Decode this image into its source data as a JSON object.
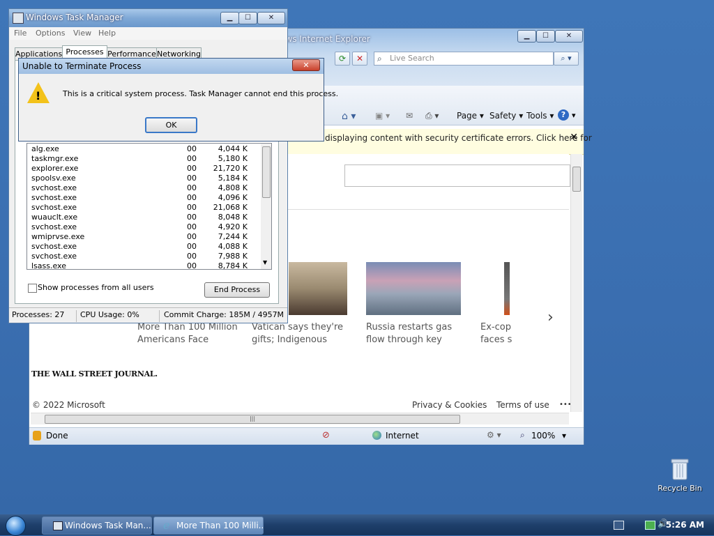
{
  "desktop": {
    "recycle_bin_label": "Recycle Bin"
  },
  "ie": {
    "title": "Windows Internet Explorer",
    "search_placeholder": "Live Search",
    "commands": [
      "Page",
      "Safety",
      "Tools"
    ],
    "infobar_message": "displaying content with security certificate errors. Click here for",
    "news": [
      {
        "line1": "More Than 100 Million",
        "line2": "Americans Face"
      },
      {
        "line1": "Vatican says they're",
        "line2": "gifts; Indigenous"
      },
      {
        "line1": "Russia restarts gas",
        "line2": "flow through key"
      },
      {
        "line1": "Ex-cop",
        "line2": "faces s"
      }
    ],
    "wsj_logo": "THE WALL STREET JOURNAL.",
    "footer_copyright": "© 2022 Microsoft",
    "footer_privacy": "Privacy & Cookies",
    "footer_terms": "Terms of use",
    "footer_more": "•••",
    "status_done": "Done",
    "status_zone": "Internet",
    "status_zoom": "100%"
  },
  "taskmgr": {
    "title": "Windows Task Manager",
    "menu": [
      "File",
      "Options",
      "View",
      "Help"
    ],
    "tabs": [
      "Applications",
      "Processes",
      "Performance",
      "Networking"
    ],
    "processes": [
      {
        "name": "alg.exe",
        "cpu": "00",
        "mem": "4,044 K"
      },
      {
        "name": "taskmgr.exe",
        "cpu": "00",
        "mem": "5,180 K"
      },
      {
        "name": "explorer.exe",
        "cpu": "00",
        "mem": "21,720 K"
      },
      {
        "name": "spoolsv.exe",
        "cpu": "00",
        "mem": "5,184 K"
      },
      {
        "name": "svchost.exe",
        "cpu": "00",
        "mem": "4,808 K"
      },
      {
        "name": "svchost.exe",
        "cpu": "00",
        "mem": "4,096 K"
      },
      {
        "name": "svchost.exe",
        "cpu": "00",
        "mem": "21,068 K"
      },
      {
        "name": "wuauclt.exe",
        "cpu": "00",
        "mem": "8,048 K"
      },
      {
        "name": "svchost.exe",
        "cpu": "00",
        "mem": "4,920 K"
      },
      {
        "name": "wmiprvse.exe",
        "cpu": "00",
        "mem": "7,244 K"
      },
      {
        "name": "svchost.exe",
        "cpu": "00",
        "mem": "4,088 K"
      },
      {
        "name": "svchost.exe",
        "cpu": "00",
        "mem": "7,988 K"
      },
      {
        "name": "lsass.exe",
        "cpu": "00",
        "mem": "8,784 K"
      }
    ],
    "show_all_label": "Show processes from all users",
    "end_process_label": "End Process",
    "status_processes": "Processes: 27",
    "status_cpu": "CPU Usage: 0%",
    "status_commit": "Commit Charge: 185M / 4957M"
  },
  "dialog": {
    "title": "Unable to Terminate Process",
    "message": "This is a critical system process.  Task Manager cannot end this process.",
    "ok_label": "OK"
  },
  "taskbar": {
    "items": [
      "Windows Task Man...",
      "More Than 100 Milli..."
    ],
    "clock": "5:26 AM"
  }
}
